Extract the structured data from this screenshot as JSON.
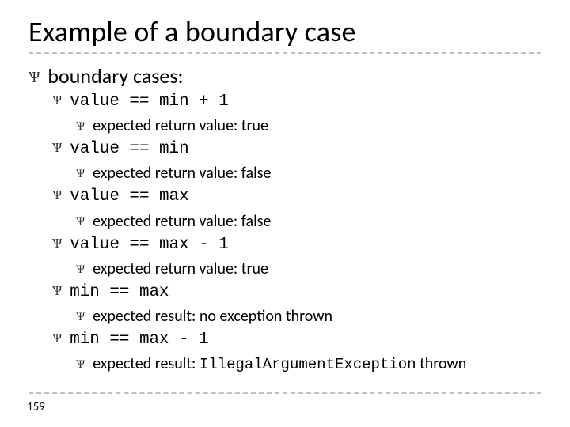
{
  "title": "Example of a boundary case",
  "heading": "boundary cases:",
  "cases": [
    {
      "cond": "value == min + 1",
      "detail_prefix": "expected return value: ",
      "detail_value": "true",
      "mono_suffix": false
    },
    {
      "cond": "value == min",
      "detail_prefix": "expected return value: ",
      "detail_value": "false",
      "mono_suffix": false
    },
    {
      "cond": "value == max",
      "detail_prefix": "expected return value: ",
      "detail_value": "false",
      "mono_suffix": false
    },
    {
      "cond": "value == max - 1",
      "detail_prefix": "expected return value: ",
      "detail_value": "true",
      "mono_suffix": false
    },
    {
      "cond": "min == max",
      "detail_prefix": "expected result: ",
      "detail_value": "no exception thrown",
      "mono_suffix": false
    },
    {
      "cond": "min == max - 1",
      "detail_prefix": "expected result: ",
      "detail_value": "IllegalArgumentException",
      "mono_suffix": true,
      "detail_tail": " thrown"
    }
  ],
  "bullet_glyph": "Ѱ",
  "page_number": "159"
}
